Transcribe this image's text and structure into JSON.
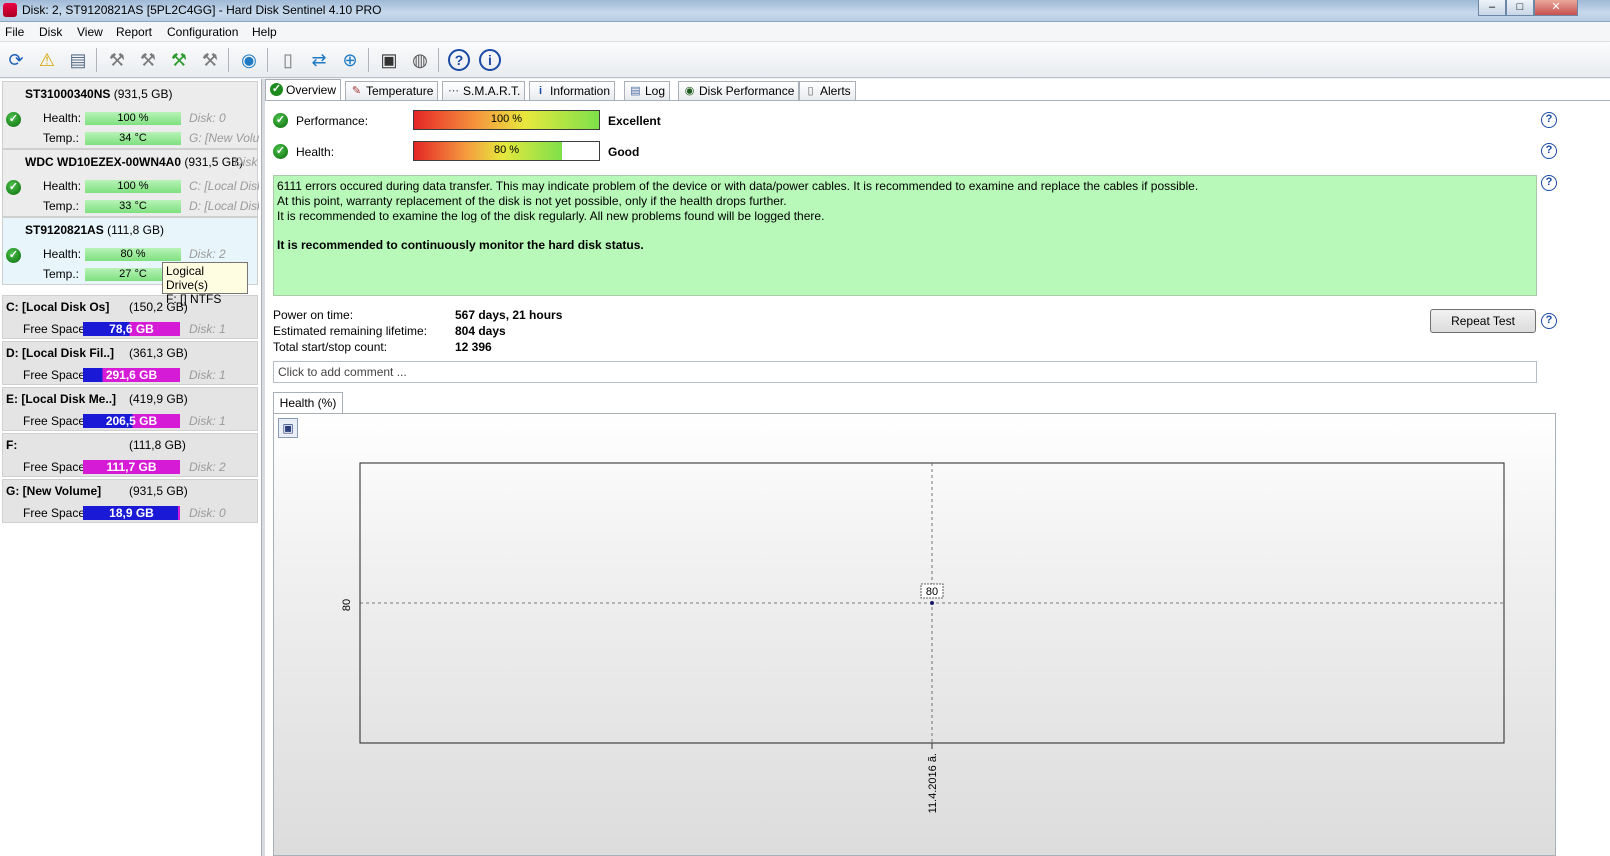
{
  "window": {
    "title": "Disk: 2, ST9120821AS [5PL2C4GG]  -  Hard Disk Sentinel 4.10 PRO",
    "minimize": "–",
    "maximize": "□",
    "close": "✕"
  },
  "menu": [
    "File",
    "Disk",
    "View",
    "Report",
    "Configuration",
    "Help"
  ],
  "toolbar": [
    "refresh-icon",
    "alert-icon",
    "disk-icon",
    "tool-1-icon",
    "tool-2-icon",
    "tool-3-icon",
    "tool-4-icon",
    "globe-icon",
    "document-icon",
    "sync-icon",
    "network-icon",
    "monitor-icon",
    "sound-icon",
    "help-icon",
    "info-icon"
  ],
  "disks": [
    {
      "name": "ST31000340NS",
      "size": "(931,5 GB)",
      "health_label": "Health:",
      "health": "100 %",
      "temp_label": "Temp.:",
      "temp": "34 °C",
      "info1": "Disk: 0",
      "info2": "G: [New Volu"
    },
    {
      "name": "WDC WD10EZEX-00WN4A0",
      "size": "(931,5 GB)",
      "health_label": "Health:",
      "health": "100 %",
      "temp_label": "Temp.:",
      "temp": "33 °C",
      "info1": "C: [Local Disk",
      "info2": "D: [Local Disk",
      "info0": "Disk"
    },
    {
      "name": "ST9120821AS",
      "size": "(111,8 GB)",
      "health_label": "Health:",
      "health": "80 %",
      "temp_label": "Temp.:",
      "temp": "27 °C",
      "info1": "Disk: 2",
      "info2": ""
    }
  ],
  "tooltip": {
    "line1": "Logical Drive(s)",
    "line2": "F: [] NTFS"
  },
  "volumes": [
    {
      "name": "C: [Local Disk Os]",
      "size": "(150,2 GB)",
      "free_label": "Free Space",
      "free": "78,6 GB",
      "disk": "Disk: 1",
      "fill": 0.52,
      "color": "#d61bd6"
    },
    {
      "name": "D: [Local Disk Fil..]",
      "size": "(361,3 GB)",
      "free_label": "Free Space",
      "free": "291,6 GB",
      "disk": "Disk: 1",
      "fill": 0.8,
      "color": "#d61bd6"
    },
    {
      "name": "E: [Local Disk Me..]",
      "size": "(419,9 GB)",
      "free_label": "Free Space",
      "free": "206,5 GB",
      "disk": "Disk: 1",
      "fill": 0.49,
      "color": "#d61bd6"
    },
    {
      "name": "F:",
      "size": "(111,8 GB)",
      "free_label": "Free Space",
      "free": "111,7 GB",
      "disk": "Disk: 2",
      "fill": 1.0,
      "color": "#d61bd6"
    },
    {
      "name": "G: [New Volume]",
      "size": "(931,5 GB)",
      "free_label": "Free Space",
      "free": "18,9 GB",
      "disk": "Disk: 0",
      "fill": 0.02,
      "color": "#d61bd6"
    }
  ],
  "tabs": [
    "Overview",
    "Temperature",
    "S.M.A.R.T.",
    "Information",
    "Log",
    "Disk Performance",
    "Alerts"
  ],
  "overview": {
    "perf_label": "Performance:",
    "perf_value": "100 %",
    "perf_fill": 1.0,
    "perf_text": "Excellent",
    "health_label": "Health:",
    "health_value": "80 %",
    "health_fill": 0.8,
    "health_text": "Good",
    "msg1": "6111 errors occured during data transfer. This may indicate problem of the device or with data/power cables. It is recommended to examine and replace the cables if possible.",
    "msg2": "At this point, warranty replacement of the disk is not yet possible, only if the health drops further.",
    "msg3": "It is recommended to examine the log of the disk regularly. All new problems found will be logged there.",
    "msg4": "It is recommended to continuously monitor the hard disk status.",
    "power_label": "Power on time:",
    "power_value": "567 days, 21 hours",
    "life_label": "Estimated remaining lifetime:",
    "life_value": "804 days",
    "count_label": "Total start/stop count:",
    "count_value": "12 396",
    "repeat": "Repeat Test",
    "comment_placeholder": "Click to add comment ...",
    "help": "?"
  },
  "health_tab": "Health (%)",
  "chart_data": {
    "type": "line",
    "x": [
      "11.4.2016 ã."
    ],
    "series": [
      {
        "values": [
          80
        ]
      }
    ],
    "ytick": "80",
    "data_label": "80",
    "grid": true
  }
}
